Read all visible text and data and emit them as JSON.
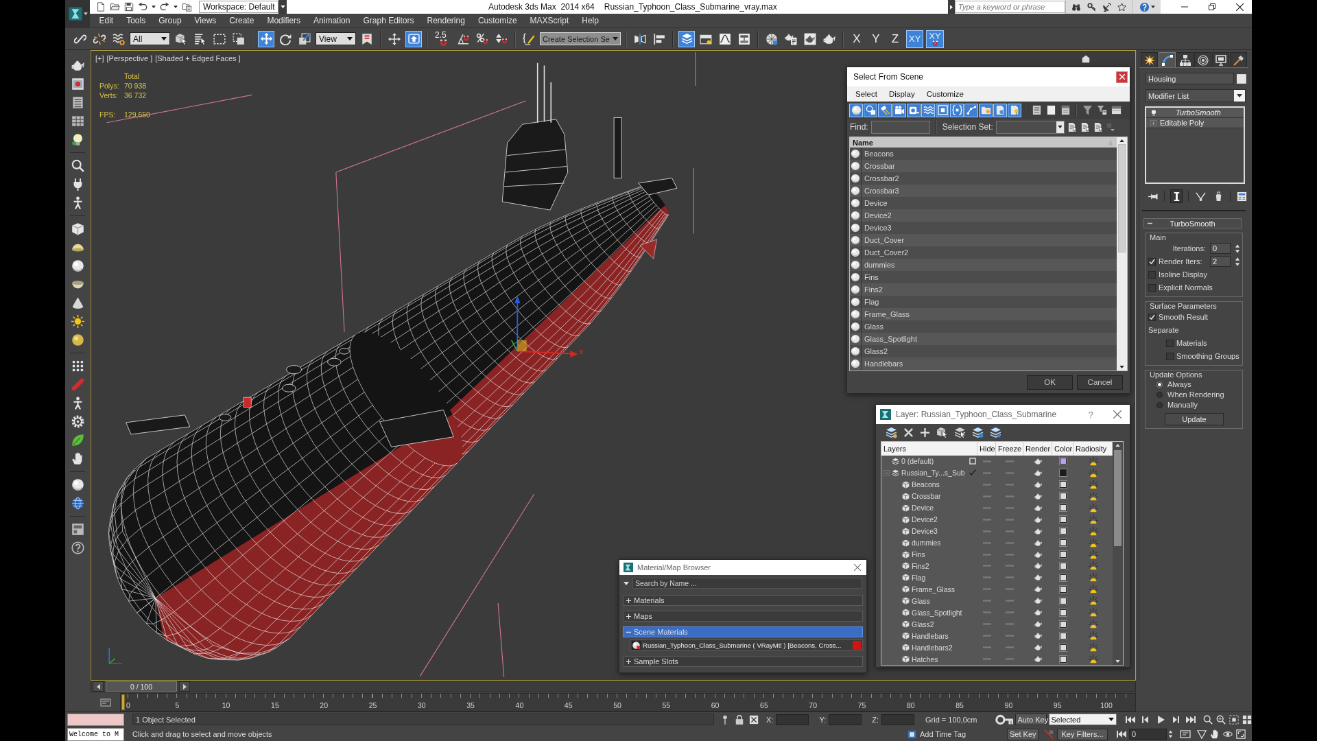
{
  "title_bar": {
    "workspace": "Workspace: Default",
    "app_title": "Autodesk 3ds Max  2014 x64",
    "file_name": "Russian_Typhoon_Class_Submarine_vray.max",
    "search": {
      "placeholder": "Type a keyword or phrase"
    }
  },
  "menu_bar": [
    "Edit",
    "Tools",
    "Group",
    "Views",
    "Create",
    "Modifiers",
    "Animation",
    "Graph Editors",
    "Rendering",
    "Customize",
    "MAXScript",
    "Help"
  ],
  "main_toolbar": [
    {
      "kind": "link",
      "selected": false
    },
    {
      "kind": "unlink",
      "selected": false
    },
    {
      "kind": "bind",
      "selected": false
    },
    {
      "kind": "dropdown",
      "value": "All"
    },
    {
      "kind": "select",
      "selected": false
    },
    {
      "kind": "select_by_name",
      "selected": false
    },
    {
      "kind": "region",
      "selected": false
    },
    {
      "kind": "crossing",
      "selected": false
    },
    {
      "kind": "separator"
    },
    {
      "kind": "move",
      "selected": true
    },
    {
      "kind": "rotate",
      "selected": false
    },
    {
      "kind": "scale",
      "selected": false
    },
    {
      "kind": "dropdown",
      "value": "View"
    },
    {
      "kind": "pivot",
      "selected": false
    },
    {
      "kind": "separator"
    },
    {
      "kind": "manipulate",
      "selected": false
    },
    {
      "kind": "keyboard",
      "selected": true
    },
    {
      "kind": "separator"
    },
    {
      "kind": "snap",
      "label": "2.5",
      "selected": false
    },
    {
      "kind": "angle_snap",
      "selected": false
    },
    {
      "kind": "percent_snap",
      "selected": false
    },
    {
      "kind": "spinner_snap",
      "selected": false
    },
    {
      "kind": "separator"
    },
    {
      "kind": "named_sets",
      "selected": false
    },
    {
      "kind": "combo",
      "value": "Create Selection Se"
    },
    {
      "kind": "separator"
    },
    {
      "kind": "mirror",
      "selected": false
    },
    {
      "kind": "align",
      "selected": false
    },
    {
      "kind": "separator"
    },
    {
      "kind": "layers",
      "selected": true
    },
    {
      "kind": "ribbon",
      "selected": false
    },
    {
      "kind": "curve_editor",
      "selected": false
    },
    {
      "kind": "schematic",
      "selected": false
    },
    {
      "kind": "separator"
    },
    {
      "kind": "material_editor",
      "selected": false
    },
    {
      "kind": "render_setup",
      "selected": false
    },
    {
      "kind": "frame_window",
      "selected": false
    },
    {
      "kind": "render",
      "selected": false
    },
    {
      "kind": "separator"
    },
    {
      "kind": "axis",
      "label": "X",
      "selected": false
    },
    {
      "kind": "axis",
      "label": "Y",
      "selected": false
    },
    {
      "kind": "axis",
      "label": "Z",
      "selected": false
    },
    {
      "kind": "axis",
      "label": "XY",
      "selected": true
    },
    {
      "kind": "axis_snap",
      "label": "XY",
      "selected": true
    }
  ],
  "viewport": {
    "labels": [
      "[+]",
      "[Perspective ]",
      "[Shaded + Edged Faces ]"
    ],
    "stats": {
      "heading": "Total",
      "rows": [
        {
          "label": "Polys:",
          "value": "70 938"
        },
        {
          "label": "Verts:",
          "value": "36 732"
        }
      ]
    },
    "fps": {
      "label": "FPS:",
      "value": "129,650"
    },
    "gizmo_label": "x"
  },
  "scene_dialog": {
    "title": "Select From Scene",
    "menu": [
      "Select",
      "Display",
      "Customize"
    ],
    "filters": [
      {
        "kind": "geometry",
        "selected": true
      },
      {
        "kind": "shapes",
        "selected": true
      },
      {
        "kind": "lights",
        "selected": true
      },
      {
        "kind": "cameras",
        "selected": true
      },
      {
        "kind": "helpers",
        "selected": true
      },
      {
        "kind": "space_warps",
        "selected": true
      },
      {
        "kind": "groups",
        "selected": true
      },
      {
        "kind": "xrefs",
        "selected": true
      },
      {
        "kind": "bones",
        "selected": true
      },
      {
        "kind": "containers",
        "selected": true
      },
      {
        "kind": "frozen",
        "selected": true
      },
      {
        "kind": "hidden",
        "selected": true
      },
      {
        "kind": "select_all",
        "selected": false
      },
      {
        "kind": "select_none",
        "selected": false
      },
      {
        "kind": "select_invert",
        "selected": false
      },
      {
        "kind": "filter",
        "selected": false
      },
      {
        "kind": "filter_tree",
        "selected": false
      },
      {
        "kind": "columns",
        "selected": false
      }
    ],
    "find": {
      "label": "Find:"
    },
    "selection_set": {
      "label": "Selection Set:"
    },
    "column": "Name",
    "objects": [
      {
        "name": "Beacons",
        "selected": false
      },
      {
        "name": "Crossbar",
        "selected": false
      },
      {
        "name": "Crossbar2",
        "selected": false
      },
      {
        "name": "Crossbar3",
        "selected": false
      },
      {
        "name": "Device",
        "selected": false
      },
      {
        "name": "Device2",
        "selected": false
      },
      {
        "name": "Device3",
        "selected": false
      },
      {
        "name": "Duct_Cover",
        "selected": false
      },
      {
        "name": "Duct_Cover2",
        "selected": false
      },
      {
        "name": "dummies",
        "selected": false
      },
      {
        "name": "Fins",
        "selected": false
      },
      {
        "name": "Fins2",
        "selected": false
      },
      {
        "name": "Flag",
        "selected": false
      },
      {
        "name": "Frame_Glass",
        "selected": false
      },
      {
        "name": "Glass",
        "selected": false
      },
      {
        "name": "Glass_Spotlight",
        "selected": false
      },
      {
        "name": "Glass2",
        "selected": false
      },
      {
        "name": "Handlebars",
        "selected": false
      }
    ],
    "buttons": [
      "OK",
      "Cancel"
    ]
  },
  "layer_dialog": {
    "title": "Layer: Russian_Typhoon_Class_Submarine",
    "help": "?",
    "columns": [
      "Layers",
      "Hide",
      "Freeze",
      "Render",
      "Color",
      "Radiosity"
    ],
    "layers": [
      {
        "name": "0 (default)",
        "current": false,
        "selected": false,
        "color": "#b9a2ec"
      },
      {
        "name": "Russian_Ty...s_Sub",
        "current": true,
        "expanded": true,
        "selected": false,
        "color": "#1c1c1c",
        "children": [
          {
            "name": "Beacons",
            "selected": false,
            "color": "#dcdcdc"
          },
          {
            "name": "Crossbar",
            "selected": false,
            "color": "#dcdcdc"
          },
          {
            "name": "Device",
            "selected": false,
            "color": "#dcdcdc"
          },
          {
            "name": "Device2",
            "selected": false,
            "color": "#dcdcdc"
          },
          {
            "name": "Device3",
            "selected": false,
            "color": "#dcdcdc"
          },
          {
            "name": "dummies",
            "selected": false,
            "color": "#dcdcdc"
          },
          {
            "name": "Fins",
            "selected": false,
            "color": "#dcdcdc"
          },
          {
            "name": "Fins2",
            "selected": false,
            "color": "#dcdcdc"
          },
          {
            "name": "Flag",
            "selected": false,
            "color": "#dcdcdc"
          },
          {
            "name": "Frame_Glass",
            "selected": false,
            "color": "#dcdcdc"
          },
          {
            "name": "Glass",
            "selected": false,
            "color": "#dcdcdc"
          },
          {
            "name": "Glass_Spotlight",
            "selected": false,
            "color": "#dcdcdc"
          },
          {
            "name": "Glass2",
            "selected": false,
            "color": "#dcdcdc"
          },
          {
            "name": "Handlebars",
            "selected": false,
            "color": "#dcdcdc"
          },
          {
            "name": "Handlebars2",
            "selected": false,
            "color": "#dcdcdc"
          },
          {
            "name": "Hatches",
            "selected": false,
            "color": "#dcdcdc"
          }
        ]
      }
    ]
  },
  "material_browser": {
    "title": "Material/Map Browser",
    "search": {
      "placeholder": "Search by Name ..."
    },
    "groups": [
      {
        "label": "Materials",
        "expanded": false,
        "selected": false
      },
      {
        "label": "Maps",
        "expanded": false,
        "selected": false
      },
      {
        "label": "Scene Materials",
        "expanded": true,
        "selected": true,
        "items": [
          {
            "label": "Russian_Typhoon_Class_Submarine ( VRayMtl ) [Beacons, Cross...",
            "color": "#d01414"
          }
        ]
      },
      {
        "label": "Sample Slots",
        "expanded": false,
        "selected": false
      }
    ]
  },
  "command_panel": {
    "tabs": [
      {
        "kind": "create",
        "selected": false
      },
      {
        "kind": "modify",
        "selected": true
      },
      {
        "kind": "hierarchy",
        "selected": false
      },
      {
        "kind": "motion",
        "selected": false
      },
      {
        "kind": "display",
        "selected": false
      },
      {
        "kind": "utilities",
        "selected": false
      }
    ],
    "object_name": "Housing",
    "modifier_list": "Modifier List",
    "stack": [
      {
        "kind": "modifier",
        "label": "TurboSmooth"
      },
      {
        "kind": "base",
        "label": "Editable Poly"
      }
    ],
    "stack_tools": [
      {
        "kind": "pin",
        "selected": false
      },
      {
        "kind": "show_end",
        "selected": true
      },
      {
        "kind": "make_unique",
        "selected": false
      },
      {
        "kind": "remove",
        "selected": false
      },
      {
        "kind": "configure",
        "selected": false
      }
    ],
    "rollout": {
      "title": "TurboSmooth",
      "expanded": true,
      "groups": [
        {
          "title": "Main",
          "controls": [
            {
              "kind": "spinner",
              "label": "Iterations:",
              "value": "0"
            },
            {
              "kind": "check_spinner",
              "label": "Render Iters:",
              "checked": true,
              "value": "2"
            },
            {
              "kind": "checkbox",
              "label": "Isoline Display",
              "checked": false
            },
            {
              "kind": "checkbox",
              "label": "Explicit Normals",
              "checked": false
            }
          ]
        },
        {
          "title": "Surface Parameters",
          "controls": [
            {
              "kind": "checkbox",
              "label": "Smooth Result",
              "checked": true
            },
            {
              "kind": "label",
              "label": "Separate"
            },
            {
              "kind": "sub_checkbox",
              "label": "Materials",
              "checked": false
            },
            {
              "kind": "sub_checkbox",
              "label": "Smoothing Groups",
              "checked": false
            }
          ]
        },
        {
          "title": "Update Options",
          "controls": [
            {
              "kind": "radio",
              "label": "Always",
              "selected": true
            },
            {
              "kind": "radio",
              "label": "When Rendering",
              "selected": false
            },
            {
              "kind": "radio",
              "label": "Manually",
              "selected": false
            },
            {
              "kind": "button",
              "label": "Update"
            }
          ]
        }
      ]
    }
  },
  "time_slider": {
    "label": "0 / 100",
    "level": 0
  },
  "ruler": [
    "0",
    "5",
    "10",
    "15",
    "20",
    "25",
    "30",
    "35",
    "40",
    "45",
    "50",
    "55",
    "60",
    "65",
    "70",
    "75",
    "80",
    "85",
    "90",
    "95",
    "100"
  ],
  "status_bar": {
    "listener_output": "Welcome to M",
    "selection": "1 Object Selected",
    "prompt": "Click and drag to select and move objects",
    "coords": [
      "X:",
      "Y:",
      "Z:"
    ],
    "grid": "Grid = 100,0cm",
    "add_time_tag": "Add Time Tag",
    "auto_key": {
      "label": "Auto Key",
      "on": false
    },
    "key_mode": "Selected",
    "set_key": "Set Key",
    "key_filters": "Key Filters...",
    "frame": "0"
  }
}
